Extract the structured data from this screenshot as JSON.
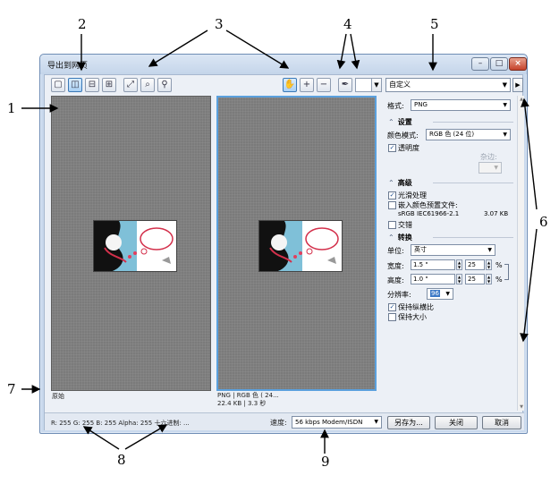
{
  "callouts": [
    "1",
    "2",
    "3",
    "4",
    "5",
    "6",
    "7",
    "8",
    "9"
  ],
  "window": {
    "title": "导出到网页",
    "minimize_glyph": "–",
    "maximize_glyph": "□",
    "close_glyph": "×"
  },
  "toolbar": {
    "preset_value": "自定义",
    "icons": [
      "single-view-icon",
      "two-up-view-icon",
      "two-up-horizontal-icon",
      "four-up-view-icon",
      "fit-to-frame-icon",
      "one-to-one-icon",
      "zoom-icon",
      "hand-tool-icon",
      "zoom-in-icon",
      "zoom-out-icon",
      "eyedropper-icon"
    ]
  },
  "preview": {
    "left_caption": "原始",
    "right_caption_line1": "PNG | RGB 色 ( 24...",
    "right_caption_line2": "22.4 KB | 3.3 秒"
  },
  "panel": {
    "format_label": "格式:",
    "format_value": "PNG",
    "settings_header": "设置",
    "color_mode_label": "颜色模式:",
    "color_mode_value": "RGB 色 (24 位)",
    "transparency_label": "透明度",
    "transparency_checked": true,
    "matte_label": "杂边:",
    "advanced_header": "高级",
    "smoothing_label": "光滑处理",
    "smoothing_checked": true,
    "embed_profile_label": "嵌入颜色预置文件:",
    "embed_profile_checked": false,
    "profile_name": "sRGB IEC61966-2.1",
    "profile_size": "3.07 KB",
    "interlace_label": "交错",
    "interlace_checked": false,
    "transform_header": "转换",
    "unit_label": "单位:",
    "unit_value": "英寸",
    "width_label": "宽度:",
    "width_value": "1.5 \"",
    "width_percent": "25",
    "height_label": "高度:",
    "height_value": "1.0 \"",
    "height_percent": "25",
    "percent_sign": "%",
    "resolution_label": "分辨率:",
    "resolution_value": "96",
    "keep_ratio_label": "保持纵横比",
    "keep_ratio_checked": true,
    "keep_size_label": "保持大小",
    "keep_size_checked": false
  },
  "status": {
    "color_readout": "R: 255  G: 255  B: 255  Alpha: 255  十六进制: ...",
    "speed_label": "速度:",
    "speed_value": "56 kbps Modem/ISDN",
    "save_as_button": "另存为...",
    "close_button": "关闭",
    "cancel_button": "取消"
  }
}
